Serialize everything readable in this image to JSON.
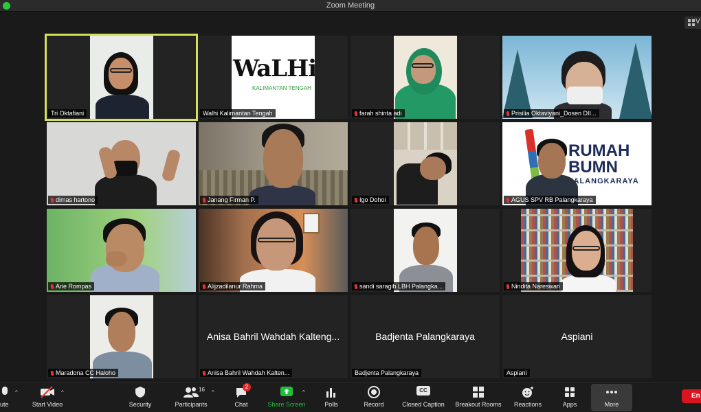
{
  "window": {
    "title": "Zoom Meeting"
  },
  "view_button": {
    "label": "V"
  },
  "participants": [
    {
      "name": "Tri Oktafiani",
      "muted": false
    },
    {
      "name": "Walhi Kalimantan Tengah",
      "muted": false,
      "logo_word": "WaLHi",
      "logo_sub": "KALIMANTAN TENGAH"
    },
    {
      "name": "farah shinta adi",
      "muted": true
    },
    {
      "name": "Prisilia Oktaviyani_Dosen DII...",
      "muted": true
    },
    {
      "name": "dimas hartono",
      "muted": true
    },
    {
      "name": "Janang Firman P.",
      "muted": true
    },
    {
      "name": "Igo Dohoi",
      "muted": true
    },
    {
      "name": "AGUS SPV RB Palangkaraya",
      "muted": true,
      "banner_line1": "RUMAH",
      "banner_line2": "BUMN",
      "banner_line3": "PALANGKARAYA"
    },
    {
      "name": "Arie Rompas",
      "muted": true
    },
    {
      "name": "Alijzadilanur Rahma",
      "muted": true
    },
    {
      "name": "sandi saragih LBH Palangka...",
      "muted": true
    },
    {
      "name": "Nindita Nareswari",
      "muted": true
    },
    {
      "name": "Maradona CC Haloho",
      "muted": true
    },
    {
      "name": "Anisa Bahril Wahdah Kalten...",
      "muted": true,
      "display_name": "Anisa Bahril Wahdah Kalteng..."
    },
    {
      "name": "Badjenta Palangkaraya",
      "muted": false,
      "display_name": "Badjenta Palangkaraya"
    },
    {
      "name": "Aspiani",
      "muted": false,
      "display_name": "Aspiani"
    }
  ],
  "toolbar": {
    "mute_label": "ute",
    "video_label": "Start Video",
    "security_label": "Security",
    "participants_label": "Participants",
    "participants_count": "16",
    "chat_label": "Chat",
    "chat_badge": "2",
    "share_label": "Share Screen",
    "polls_label": "Polls",
    "record_label": "Record",
    "caption_label": "Closed Caption",
    "caption_icon_text": "CC",
    "breakout_label": "Breakout Rooms",
    "reactions_label": "Reactions",
    "apps_label": "Apps",
    "more_label": "More",
    "end_label": "En"
  },
  "colors": {
    "active_speaker_border": "#d2e05a",
    "share_green": "#1fbf3c",
    "end_red": "#d9141e",
    "muted_red": "#e23333"
  },
  "icons": [
    "microphone-icon",
    "video-off-icon",
    "shield-icon",
    "people-icon",
    "chat-icon",
    "share-screen-icon",
    "polls-icon",
    "record-icon",
    "cc-icon",
    "breakout-icon",
    "reactions-icon",
    "apps-icon",
    "more-icon",
    "grid-view-icon"
  ]
}
